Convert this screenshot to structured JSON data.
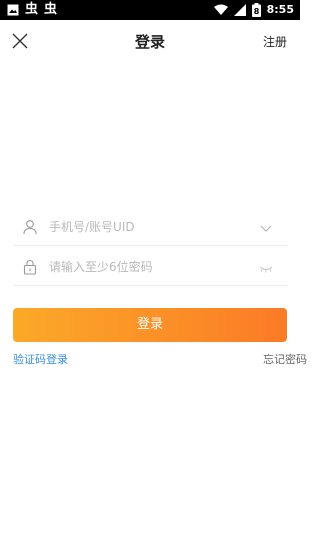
{
  "status_bar": {
    "time": "8:55",
    "battery_level": "8",
    "notification_icons": [
      "image-icon",
      "cat-icon",
      "cat-icon"
    ],
    "right_icons": [
      "wifi-icon",
      "cellular-icon",
      "battery-icon"
    ]
  },
  "nav": {
    "title": "登录",
    "register_label": "注册",
    "close_icon": "close-icon"
  },
  "form": {
    "account_placeholder": "手机号/账号UID",
    "account_value": "",
    "password_placeholder": "请输入至少6位密码",
    "password_value": "",
    "account_icon": "user-icon",
    "password_icon": "lock-icon",
    "dropdown_icon": "chevron-down-icon",
    "visibility_icon": "eye-closed-icon",
    "login_label": "登录"
  },
  "links": {
    "sms_login": "验证码登录",
    "forgot_password": "忘记密码"
  },
  "colors": {
    "primary_gradient_start": "#fba928",
    "primary_gradient_end": "#fb7b26",
    "link_blue": "#3a8ee6",
    "status_bar_bg": "#000000"
  }
}
